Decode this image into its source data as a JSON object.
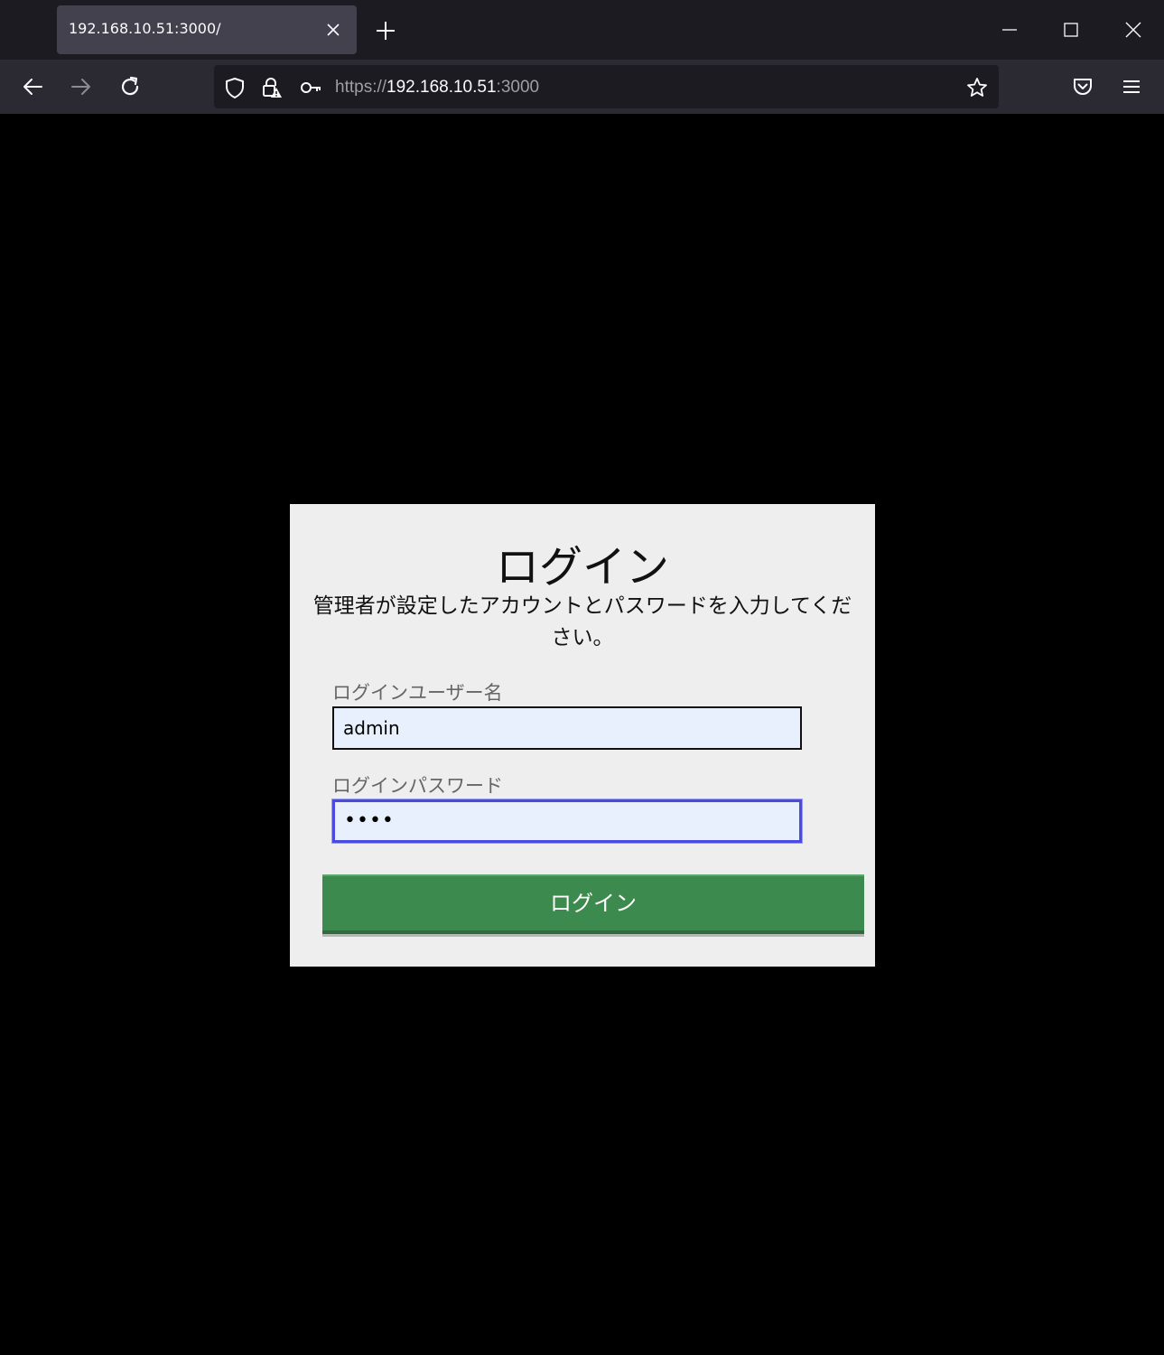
{
  "browser": {
    "tab_title": "192.168.10.51:3000/",
    "url_scheme": "https://",
    "url_host": "192.168.10.51",
    "url_port": ":3000"
  },
  "icons": {
    "back": "arrow-left-icon",
    "forward": "arrow-right-icon",
    "reload": "reload-icon",
    "shield": "tracking-protection-shield-icon",
    "lock": "insecure-lock-icon",
    "key": "key-icon",
    "bookmark": "star-icon",
    "pocket": "pocket-icon",
    "menu": "hamburger-menu-icon",
    "new_tab": "plus-icon",
    "tab_close": "close-icon"
  },
  "login": {
    "title": "ログイン",
    "description": "管理者が設定したアカウントとパスワードを入力してください。",
    "username_label": "ログインユーザー名",
    "username_value": "admin",
    "password_label": "ログインパスワード",
    "password_value": "••••",
    "submit_label": "ログイン"
  },
  "colors": {
    "page_background": "#000000",
    "card_background": "#eeeeee",
    "input_background": "#e8f0fe",
    "button_green": "#3d8a4e",
    "focus_border": "#4a4ae0"
  }
}
